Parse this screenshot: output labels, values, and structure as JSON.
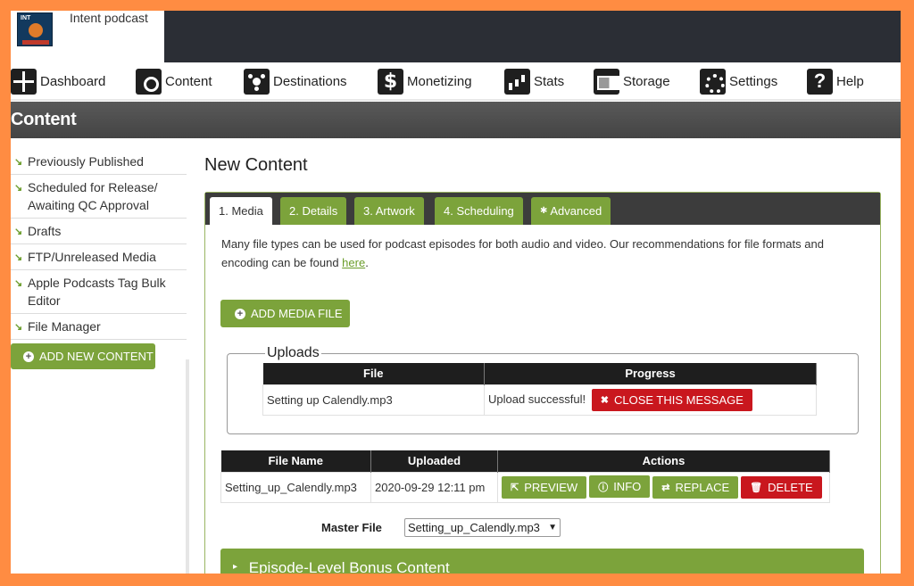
{
  "brand": {
    "name": "Intent podcast",
    "logo_text": "INT"
  },
  "nav": [
    {
      "label": "Dashboard",
      "icon": "dashboard-icon"
    },
    {
      "label": "Content",
      "icon": "content-icon"
    },
    {
      "label": "Destinations",
      "icon": "destinations-icon"
    },
    {
      "label": "Monetizing",
      "icon": "dollar-icon"
    },
    {
      "label": "Stats",
      "icon": "stats-icon"
    },
    {
      "label": "Storage",
      "icon": "storage-icon"
    },
    {
      "label": "Settings",
      "icon": "gears-icon"
    },
    {
      "label": "Help",
      "icon": "question-icon"
    }
  ],
  "page": {
    "title": "Content"
  },
  "sidebar": {
    "items": [
      {
        "label": "Previously Published"
      },
      {
        "label": "Scheduled for Release/ Awaiting QC Approval"
      },
      {
        "label": "Drafts"
      },
      {
        "label": "FTP/Unreleased Media"
      },
      {
        "label": "Apple Podcasts Tag Bulk Editor"
      },
      {
        "label": "File Manager"
      }
    ],
    "add_button": "ADD NEW CONTENT"
  },
  "main": {
    "title": "New Content",
    "tabs": [
      {
        "label": "1. Media"
      },
      {
        "label": "2. Details"
      },
      {
        "label": "3. Artwork"
      },
      {
        "label": "4. Scheduling"
      },
      {
        "label": "Advanced"
      }
    ],
    "intro_text": "Many file types can be used for podcast episodes for both audio and video. Our recommendations for file formats and encoding can be found ",
    "intro_link": "here",
    "intro_end": ".",
    "add_media_button": "ADD MEDIA FILE",
    "uploads": {
      "legend": "Uploads",
      "headers": [
        "File",
        "Progress"
      ],
      "row": {
        "file": "Setting up Calendly.mp3",
        "status": "Upload successful!",
        "close_button": "CLOSE THIS MESSAGE"
      }
    },
    "files": {
      "headers": [
        "File Name",
        "Uploaded",
        "Actions"
      ],
      "row": {
        "name": "Setting_up_Calendly.mp3",
        "uploaded": "2020-09-29 12:11 pm",
        "actions": [
          "PREVIEW",
          "INFO",
          "REPLACE",
          "DELETE"
        ]
      }
    },
    "master_file": {
      "label": "Master File",
      "value": "Setting_up_Calendly.mp3"
    },
    "bonus_section": "Episode-Level Bonus Content"
  },
  "colors": {
    "accent_green": "#7ca33b",
    "danger_red": "#c9171e",
    "frame_orange": "#ff8c42",
    "header_dark": "#2b2e35"
  }
}
